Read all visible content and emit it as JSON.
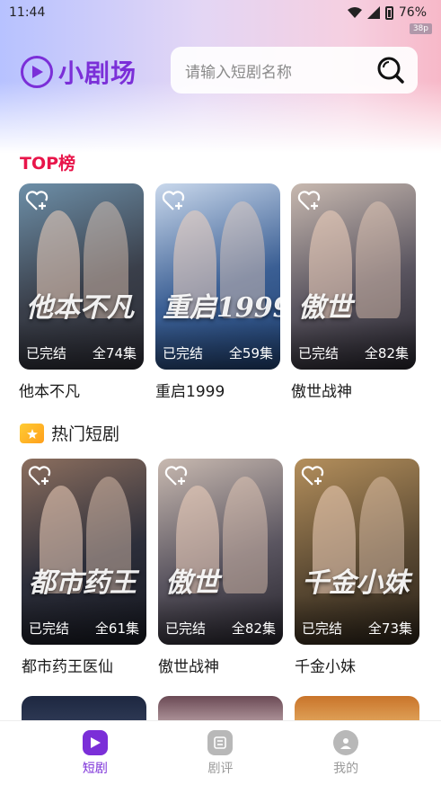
{
  "status_bar": {
    "time": "11:44",
    "battery": "76%",
    "fps": "38p"
  },
  "header": {
    "logo_text": "小剧场",
    "search_placeholder": "请输入短剧名称"
  },
  "sections": {
    "top": {
      "title": "TOP榜"
    },
    "hot": {
      "title": "热门短剧"
    }
  },
  "top_dramas": [
    {
      "name": "他本不凡",
      "status": "已完结",
      "episodes": "全74集",
      "art": "他本不凡",
      "colors": [
        "#3a3f4a",
        "#6d8fa8",
        "#2b2b33"
      ]
    },
    {
      "name": "重启1999",
      "status": "已完结",
      "episodes": "全59集",
      "art": "重启1999",
      "colors": [
        "#3b5f94",
        "#c9d8ec",
        "#1f3f6e"
      ]
    },
    {
      "name": "傲世战神",
      "status": "已完结",
      "episodes": "全82集",
      "art": "傲世",
      "colors": [
        "#5a5560",
        "#c8b9b0",
        "#26242c"
      ]
    }
  ],
  "hot_dramas": [
    {
      "name": "都市药王医仙",
      "status": "已完结",
      "episodes": "全61集",
      "art": "都市药王",
      "colors": [
        "#2c2e3a",
        "#8b6e5e",
        "#161820"
      ]
    },
    {
      "name": "傲世战神",
      "status": "已完结",
      "episodes": "全82集",
      "art": "傲世",
      "colors": [
        "#5a5560",
        "#c8b9b0",
        "#26242c"
      ]
    },
    {
      "name": "千金小妹",
      "status": "已完结",
      "episodes": "全73集",
      "art": "千金小妹",
      "colors": [
        "#5b4a33",
        "#b48f5c",
        "#2a2218"
      ]
    }
  ],
  "tabbar": {
    "items": [
      {
        "label": "短剧",
        "active": true
      },
      {
        "label": "剧评",
        "active": false
      },
      {
        "label": "我的",
        "active": false
      }
    ],
    "active_color": "#7b2fd8",
    "inactive_color": "#9a9a9a"
  }
}
